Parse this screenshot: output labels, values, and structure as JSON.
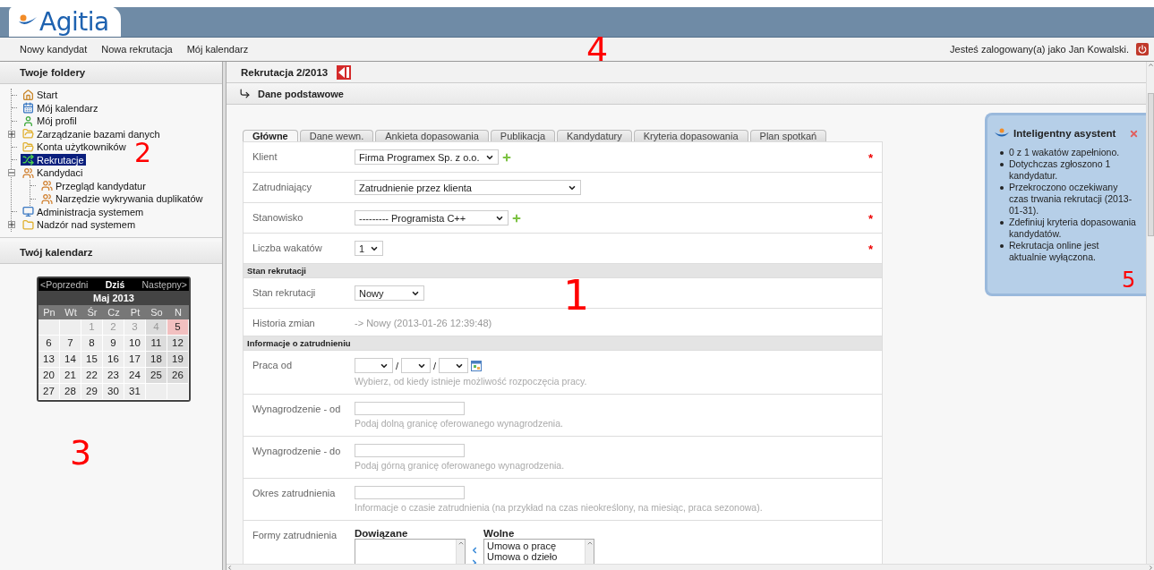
{
  "header": {
    "logo": "Agitia",
    "menu": [
      "Nowy kandydat",
      "Nowa rekrutacja",
      "Mój kalendarz"
    ],
    "user_text": "Jesteś zalogowany(a) jako Jan Kowalski.",
    "callout": "4"
  },
  "sidebar": {
    "folders_title": "Twoje foldery",
    "tree_callout": "2",
    "tree": [
      {
        "label": "Start",
        "selected": false
      },
      {
        "label": "Mój kalendarz",
        "selected": false
      },
      {
        "label": "Mój profil",
        "selected": false
      },
      {
        "label": "Zarządzanie bazami danych",
        "selected": false,
        "expanded": false
      },
      {
        "label": "Konta użytkowników",
        "selected": false
      },
      {
        "label": "Rekrutacje",
        "selected": true
      },
      {
        "label": "Kandydaci",
        "selected": false,
        "expanded": true,
        "children": [
          {
            "label": "Przegląd kandydatur",
            "selected": false
          },
          {
            "label": "Narzędzie wykrywania duplikatów",
            "selected": false
          }
        ]
      },
      {
        "label": "Administracja systemem",
        "selected": false
      },
      {
        "label": "Nadzór nad systemem",
        "selected": false,
        "expanded": false
      }
    ],
    "calendar_title": "Twój kalendarz",
    "calendar": {
      "prev": "<Poprzedni",
      "today": "Dziś",
      "next": "Następny>",
      "month": "Maj 2013",
      "weekdays": [
        "Pn",
        "Wt",
        "Śr",
        "Cz",
        "Pt",
        "So",
        "N"
      ],
      "weeks": [
        [
          {
            "kind": "empty"
          },
          {
            "kind": "empty"
          },
          {
            "kind": "day",
            "day": "1",
            "muted": true,
            "today": false
          },
          {
            "kind": "day",
            "day": "2",
            "muted": true,
            "today": false
          },
          {
            "kind": "day",
            "day": "3",
            "muted": true,
            "today": false
          },
          {
            "kind": "day",
            "day": "4",
            "muted": true,
            "today": false
          },
          {
            "kind": "day",
            "day": "5",
            "muted": false,
            "today": true
          }
        ],
        [
          {
            "kind": "day",
            "day": "6",
            "muted": false,
            "today": false
          },
          {
            "kind": "day",
            "day": "7",
            "muted": false,
            "today": false
          },
          {
            "kind": "day",
            "day": "8",
            "muted": false,
            "today": false
          },
          {
            "kind": "day",
            "day": "9",
            "muted": false,
            "today": false
          },
          {
            "kind": "day",
            "day": "10",
            "muted": false,
            "today": false
          },
          {
            "kind": "day",
            "day": "11",
            "muted": false,
            "today": false
          },
          {
            "kind": "day",
            "day": "12",
            "muted": false,
            "today": false
          }
        ],
        [
          {
            "kind": "day",
            "day": "13",
            "muted": false,
            "today": false
          },
          {
            "kind": "day",
            "day": "14",
            "muted": false,
            "today": false
          },
          {
            "kind": "day",
            "day": "15",
            "muted": false,
            "today": false
          },
          {
            "kind": "day",
            "day": "16",
            "muted": false,
            "today": false
          },
          {
            "kind": "day",
            "day": "17",
            "muted": false,
            "today": false
          },
          {
            "kind": "day",
            "day": "18",
            "muted": false,
            "today": false
          },
          {
            "kind": "day",
            "day": "19",
            "muted": false,
            "today": false
          }
        ],
        [
          {
            "kind": "day",
            "day": "20",
            "muted": false,
            "today": false
          },
          {
            "kind": "day",
            "day": "21",
            "muted": false,
            "today": false
          },
          {
            "kind": "day",
            "day": "22",
            "muted": false,
            "today": false
          },
          {
            "kind": "day",
            "day": "23",
            "muted": false,
            "today": false
          },
          {
            "kind": "day",
            "day": "24",
            "muted": false,
            "today": false
          },
          {
            "kind": "day",
            "day": "25",
            "muted": false,
            "today": false
          },
          {
            "kind": "day",
            "day": "26",
            "muted": false,
            "today": false
          }
        ],
        [
          {
            "kind": "day",
            "day": "27",
            "muted": false,
            "today": false
          },
          {
            "kind": "day",
            "day": "28",
            "muted": false,
            "today": false
          },
          {
            "kind": "day",
            "day": "29",
            "muted": false,
            "today": false
          },
          {
            "kind": "day",
            "day": "30",
            "muted": false,
            "today": false
          },
          {
            "kind": "day",
            "day": "31",
            "muted": false,
            "today": false
          },
          {
            "kind": "empty"
          },
          {
            "kind": "empty"
          }
        ]
      ]
    },
    "callout": "3"
  },
  "main": {
    "title": "Rekrutacja 2/2013",
    "breadcrumb": "Dane podstawowe",
    "callout": "1",
    "tabs": [
      {
        "label": "Główne",
        "selected": true
      },
      {
        "label": "Dane wewn.",
        "selected": false
      },
      {
        "label": "Ankieta dopasowania",
        "selected": false
      },
      {
        "label": "Publikacja",
        "selected": false
      },
      {
        "label": "Kandydatury",
        "selected": false
      },
      {
        "label": "Kryteria dopasowania",
        "selected": false
      },
      {
        "label": "Plan spotkań",
        "selected": false
      }
    ],
    "form": [
      {
        "kind": "select",
        "label": "Klient",
        "value": "Firma Programex Sp. z o.o.",
        "addable": true,
        "required_mark": "*"
      },
      {
        "kind": "select",
        "label": "Zatrudniający",
        "value": "Zatrudnienie przez klienta",
        "addable": false
      },
      {
        "kind": "select",
        "label": "Stanowisko",
        "value": "--------- Programista C++",
        "addable": true,
        "required_mark": "*"
      },
      {
        "kind": "select",
        "label": "Liczba wakatów",
        "value": "1",
        "addable": false,
        "required_mark": "*"
      },
      {
        "kind": "section",
        "title": "Stan rekrutacji"
      },
      {
        "kind": "select",
        "label": "Stan rekrutacji",
        "value": "Nowy",
        "addable": false
      },
      {
        "kind": "info",
        "label": "Historia zmian",
        "value": "-> Nowy (2013-01-26 12:39:48)"
      },
      {
        "kind": "section",
        "title": "Informacje o zatrudnieniu"
      },
      {
        "kind": "date",
        "label": "Praca od",
        "separators": [
          "/",
          "/"
        ],
        "help": "Wybierz, od kiedy istnieje możliwość rozpoczęcia pracy."
      },
      {
        "kind": "text",
        "label": "Wynagrodzenie - od",
        "help": "Podaj dolną granicę oferowanego wynagrodzenia."
      },
      {
        "kind": "text",
        "label": "Wynagrodzenie - do",
        "help": "Podaj górną granicę oferowanego wynagrodzenia."
      },
      {
        "kind": "text",
        "label": "Okres zatrudnienia",
        "help": "Informacje o czasie zatrudnienia (na przykład na czas nieokreślony, na miesiąc, praca sezonowa)."
      },
      {
        "kind": "listpair",
        "label": "Formy zatrudnienia",
        "lists": [
          {
            "title": "Dowiązane"
          },
          {
            "title": "Wolne",
            "options": [
              "Umowa o pracę",
              "Umowa o dzieło"
            ]
          }
        ]
      }
    ]
  },
  "assistant": {
    "title": "Inteligentny asystent",
    "callout": "5",
    "items": [
      "0 z 1 wakatów zapełniono.",
      "Dotychczas zgłoszono 1 kandydatur.",
      "Przekroczono oczekiwany czas trwania rekrutacji (2013-01-31).",
      "Zdefiniuj kryteria dopasowania kandydatów.",
      "Rekrutacja online jest aktualnie wyłączona."
    ]
  }
}
